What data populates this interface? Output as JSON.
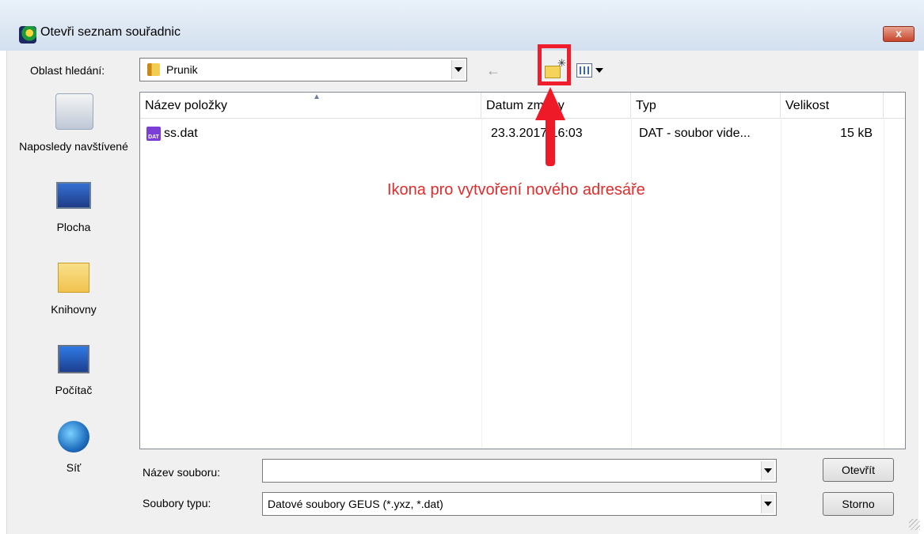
{
  "window": {
    "title": "Otevři seznam souřadnic",
    "close_label": "x"
  },
  "lookin": {
    "label": "Oblast hledání:",
    "value": "Prunik"
  },
  "toolbar": {
    "back_glyph": "←",
    "up_glyph": "↑",
    "new_folder_spark": "✳"
  },
  "places": [
    {
      "label": "Naposledy navštívené",
      "icon": "recent-places-icon"
    },
    {
      "label": "Plocha",
      "icon": "desktop-icon"
    },
    {
      "label": "Knihovny",
      "icon": "libraries-icon"
    },
    {
      "label": "Počítač",
      "icon": "computer-icon"
    },
    {
      "label": "Síť",
      "icon": "network-icon"
    }
  ],
  "list": {
    "columns": [
      "Název položky",
      "Datum změny",
      "Typ",
      "Velikost"
    ],
    "sort_glyph": "▲",
    "rows": [
      {
        "name": "ss.dat",
        "date": "23.3.2017 16:03",
        "type": "DAT - soubor vide...",
        "size": "15 kB",
        "icon_text": "DAT"
      }
    ]
  },
  "annotation": {
    "text": "Ikona pro vytvoření nového adresáře",
    "color": "#e22b2b"
  },
  "filename": {
    "label": "Název souboru:",
    "value": ""
  },
  "filetype": {
    "label": "Soubory typu:",
    "value": "Datové soubory GEUS (*.yxz, *.dat)"
  },
  "buttons": {
    "open": "Otevřít",
    "cancel": "Storno"
  }
}
